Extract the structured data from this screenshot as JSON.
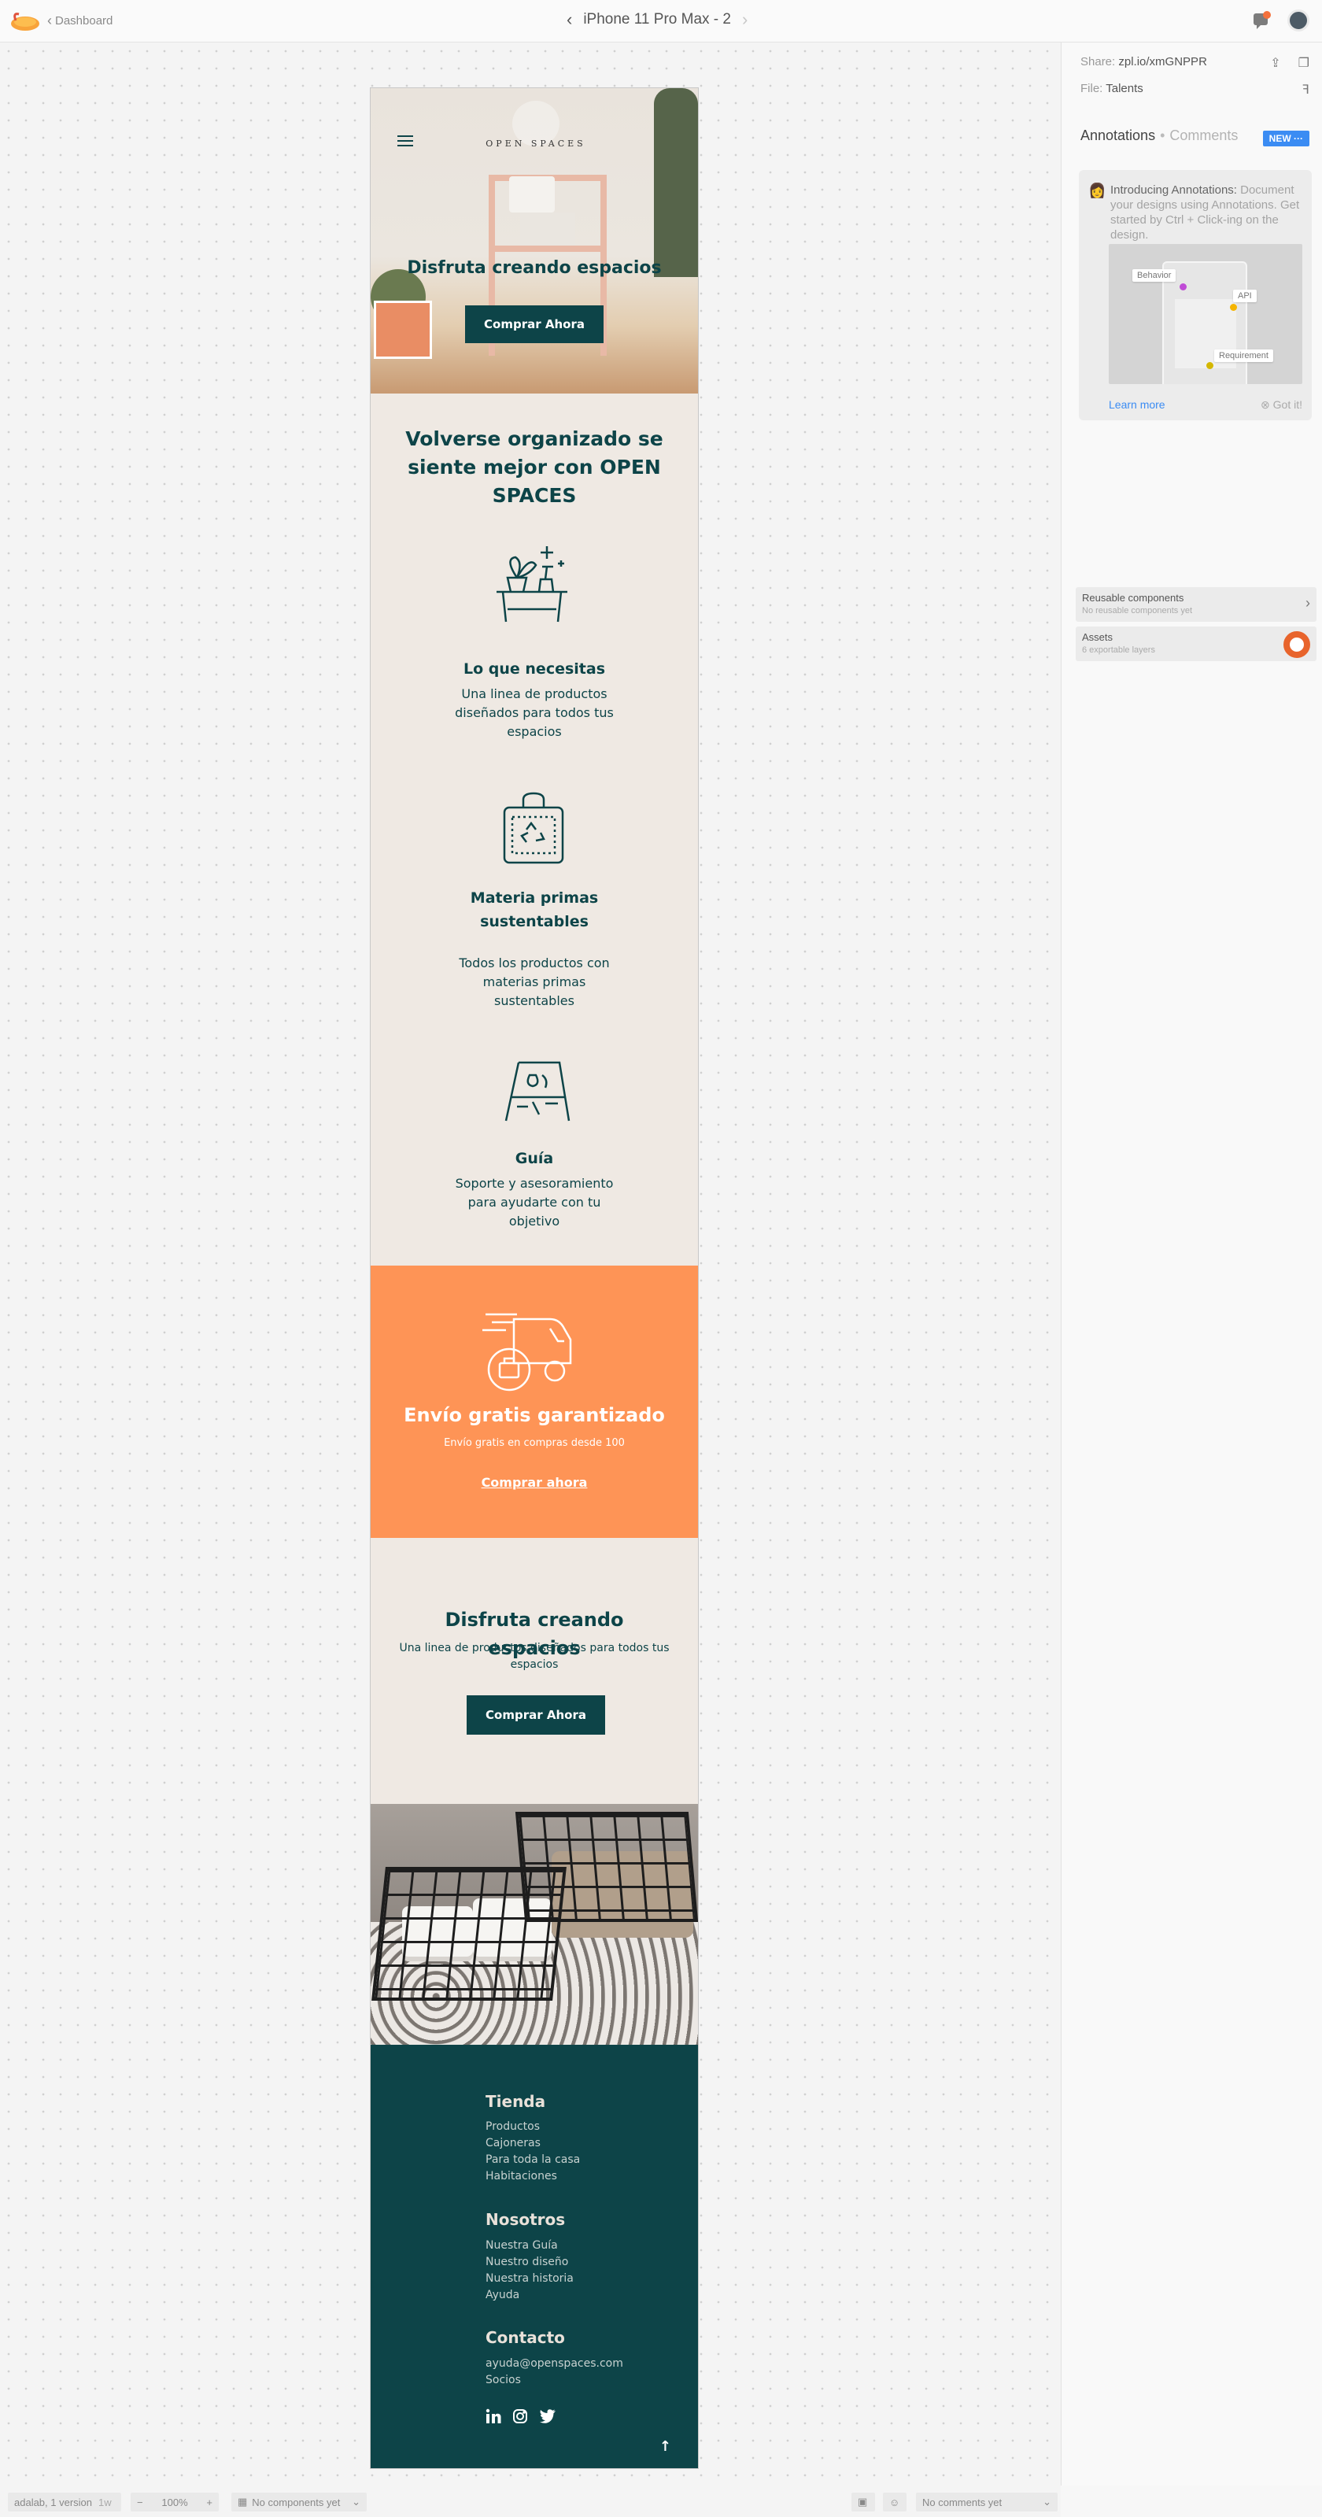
{
  "topbar": {
    "back_label": "Dashboard",
    "screen_title": "iPhone 11 Pro Max - 2"
  },
  "right_panel": {
    "share_label": "Share:",
    "share_value": "zpl.io/xmGNPPR",
    "file_label": "File:",
    "file_value": "Talents",
    "tab_annotations": "Annotations",
    "tab_comments": "Comments",
    "new_badge": "NEW",
    "intro_title": "Introducing Annotations:",
    "intro_text": "Document your designs using Annotations. Get started by Ctrl + Click-ing on the design.",
    "illus_tags": [
      "Behavior",
      "API",
      "Requirement"
    ],
    "learn_more": "Learn more",
    "got_it": "Got it!",
    "reusable_title": "Reusable components",
    "reusable_sub": "No reusable components yet",
    "assets_title": "Assets",
    "assets_sub": "6 exportable layers"
  },
  "bottombar": {
    "version": "adalab, 1 version",
    "age": "1w",
    "zoom": "100%",
    "components": "No components yet",
    "comments": "No comments yet"
  },
  "design": {
    "brand": "OPEN SPACES",
    "hero_title": "Disfruta creando espacios",
    "hero_button": "Comprar Ahora",
    "section_title": "Volverse organizado se siente mejor con OPEN SPACES",
    "features": [
      {
        "icon": "plants-table-icon",
        "title": "Lo que necesitas",
        "desc": "Una linea de productos diseñados para todos tus espacios"
      },
      {
        "icon": "recycle-bag-icon",
        "title": "Materia primas sustentables",
        "desc": "Todos los productos con materias primas sustentables"
      },
      {
        "icon": "guide-board-icon",
        "title": "Guía",
        "desc": "Soporte y asesoramiento para ayudarte con tu objetivo"
      }
    ],
    "shipping": {
      "title": "Envío gratis garantizado",
      "subtitle": "Envío gratis en compras desde 100",
      "link": "Comprar ahora"
    },
    "cta": {
      "title": "Disfruta creando espacios",
      "desc": "Una linea de productos diseñados para todos tus espacios",
      "button": "Comprar Ahora"
    },
    "footer": {
      "shop_heading": "Tienda",
      "shop_links": [
        "Productos",
        "Cajoneras",
        "Para toda la casa",
        "Habitaciones"
      ],
      "about_heading": "Nosotros",
      "about_links": [
        "Nuestra Guía",
        "Nuestro diseño",
        "Nuestra historia",
        "Ayuda"
      ],
      "contact_heading": "Contacto",
      "contact_links": [
        "ayuda@openspaces.com",
        "Socios"
      ],
      "social": [
        "linkedin-icon",
        "instagram-icon",
        "twitter-icon"
      ]
    },
    "colors": {
      "primary": "#0d4448",
      "background": "#efe9e3",
      "accent": "#fe9456"
    }
  }
}
